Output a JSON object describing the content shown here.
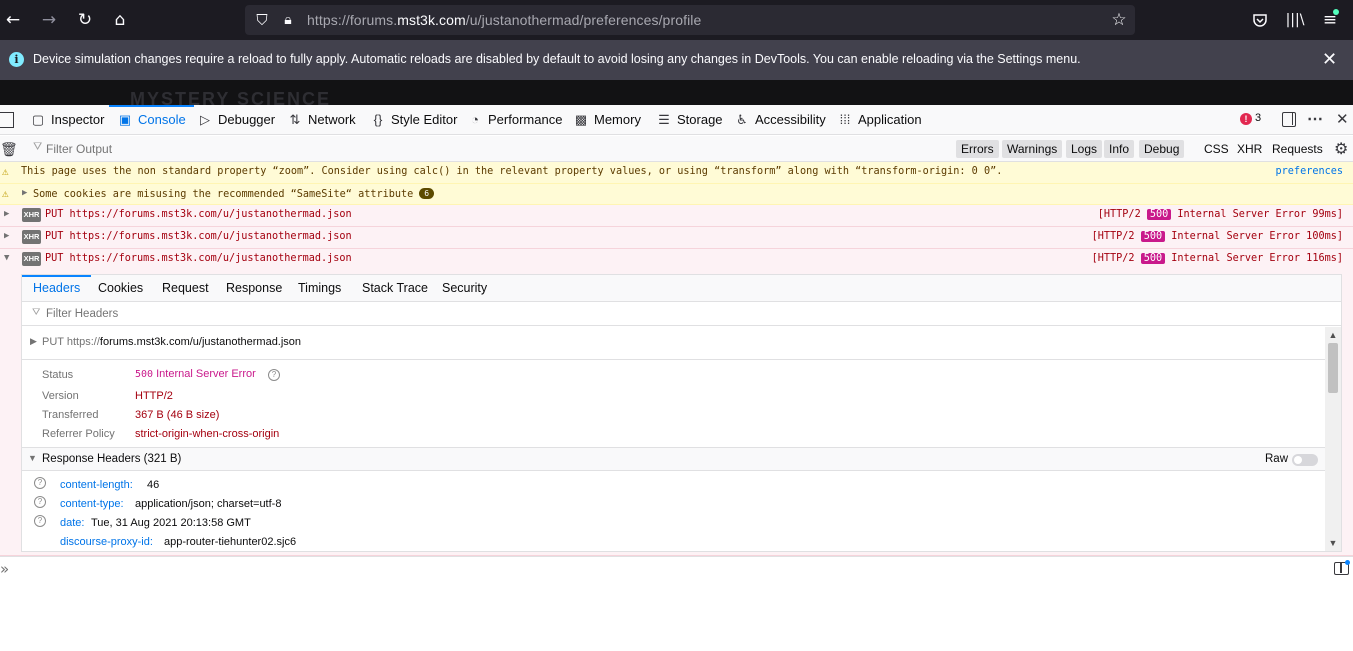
{
  "browser": {
    "url_domain_prefix": "https://forums.",
    "url_domain": "mst3k.com",
    "url_path": "/u/justanothermad/preferences/profile",
    "icons": {
      "back": "back-arrow-icon",
      "forward": "forward-arrow-icon",
      "reload": "reload-icon",
      "home": "home-icon",
      "shield": "tracking-shield-icon",
      "lock": "lock-icon",
      "star": "bookmark-star-icon",
      "pocket": "pocket-icon",
      "library": "library-icon",
      "menu": "hamburger-menu-icon"
    }
  },
  "notification": {
    "text": "Device simulation changes require a reload to fully apply. Automatic reloads are disabled by default to avoid losing any changes in DevTools. You can enable reloading via the Settings menu.",
    "close": "✕"
  },
  "page_bg_text": "MYSTERY SCIENCE",
  "devtools": {
    "tabs": [
      {
        "label": "Inspector",
        "icon": "inspector-icon"
      },
      {
        "label": "Console",
        "icon": "console-icon"
      },
      {
        "label": "Debugger",
        "icon": "debugger-icon"
      },
      {
        "label": "Network",
        "icon": "network-icon"
      },
      {
        "label": "Style Editor",
        "icon": "style-editor-icon"
      },
      {
        "label": "Performance",
        "icon": "performance-icon"
      },
      {
        "label": "Memory",
        "icon": "memory-icon"
      },
      {
        "label": "Storage",
        "icon": "storage-icon"
      },
      {
        "label": "Accessibility",
        "icon": "accessibility-icon"
      },
      {
        "label": "Application",
        "icon": "application-icon"
      }
    ],
    "selected_tab": "Console",
    "error_count": "3",
    "filter_placeholder": "Filter Output",
    "filter_buttons": [
      "Errors",
      "Warnings",
      "Logs",
      "Info",
      "Debug"
    ],
    "filter_toggles": [
      "CSS",
      "XHR",
      "Requests"
    ]
  },
  "messages": {
    "zoom_warning": "This page uses the non standard property “zoom”. Consider using calc() in the relevant property values, or using “transform” along with “transform-origin: 0 0”.",
    "zoom_link": "preferences",
    "cookie_warning": "Some cookies are misusing the recommended “SameSite“ attribute",
    "cookie_count": "6",
    "xhr_badge": "XHR",
    "requests": [
      {
        "method": "PUT",
        "url": "https://forums.mst3k.com/u/justanothermad.json",
        "proto": "[HTTP/2",
        "code": "500",
        "status": "Internal Server Error 99ms]"
      },
      {
        "method": "PUT",
        "url": "https://forums.mst3k.com/u/justanothermad.json",
        "proto": "[HTTP/2",
        "code": "500",
        "status": "Internal Server Error 100ms]"
      },
      {
        "method": "PUT",
        "url": "https://forums.mst3k.com/u/justanothermad.json",
        "proto": "[HTTP/2",
        "code": "500",
        "status": "Internal Server Error 116ms]"
      }
    ]
  },
  "details": {
    "tabs": [
      "Headers",
      "Cookies",
      "Request",
      "Response",
      "Timings",
      "Stack Trace",
      "Security"
    ],
    "selected_tab": "Headers",
    "filter_placeholder": "Filter Headers",
    "request_method": "PUT",
    "request_scheme": "https://",
    "request_rest": "forums.mst3k.com/u/justanothermad.json",
    "summary": {
      "status_label": "Status",
      "status_code": "500",
      "status_text": "Internal Server Error",
      "version_label": "Version",
      "version": "HTTP/2",
      "transferred_label": "Transferred",
      "transferred": "367 B (46 B size)",
      "referrer_label": "Referrer Policy",
      "referrer": "strict-origin-when-cross-origin"
    },
    "response_headers_title": "Response Headers (321 B)",
    "raw_label": "Raw",
    "raw_toggle_on": false,
    "headers": [
      {
        "name": "content-length:",
        "value": "46"
      },
      {
        "name": "content-type:",
        "value": "application/json; charset=utf-8"
      },
      {
        "name": "date:",
        "value": "Tue, 31 Aug 2021 20:13:58 GMT"
      },
      {
        "name": "discourse-proxy-id:",
        "value": "app-router-tiehunter02.sjc6"
      }
    ]
  },
  "console_input": {
    "prompt": "»",
    "value": ""
  },
  "colors": {
    "accent": "#0a84ff",
    "error_bg": "#fdf2f5",
    "error_text": "#a4000f",
    "warn_bg": "#fffbd6",
    "code500": "#c9198b"
  }
}
